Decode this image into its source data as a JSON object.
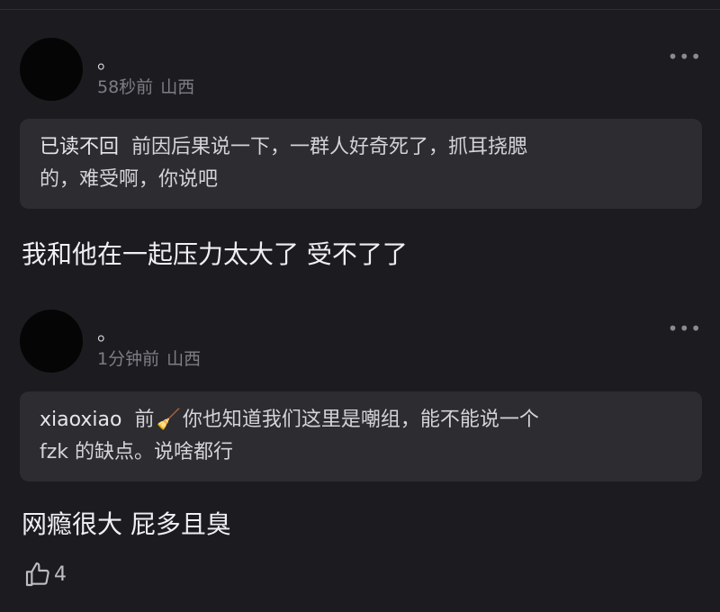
{
  "comments": [
    {
      "username": "。",
      "time": "58秒前",
      "location": "山西",
      "more_icon": "more-horizontal-icon",
      "quote": {
        "user": "已读不回",
        "text_line1": "前因后果说一下，一群人好奇死了，抓耳挠腮",
        "text_line2": "的，难受啊，你说吧"
      },
      "text": "我和他在一起压力太大了 受不了了"
    },
    {
      "username": "。",
      "time": "1分钟前",
      "location": "山西",
      "more_icon": "more-horizontal-icon",
      "quote": {
        "user": "xiaoxiao",
        "text_prefix": "前",
        "emoji": "🧹",
        "text_line1": "你也知道我们这里是嘲组，能不能说一个",
        "text_line2": "fzk 的缺点。说啥都行"
      },
      "text": "网瘾很大 屁多且臭",
      "likes": "4",
      "like_icon": "thumbs-up-icon"
    }
  ],
  "colors": {
    "background": "#1c1c20",
    "quote_bg": "#2c2c31",
    "meta_text": "#7d7d84"
  }
}
